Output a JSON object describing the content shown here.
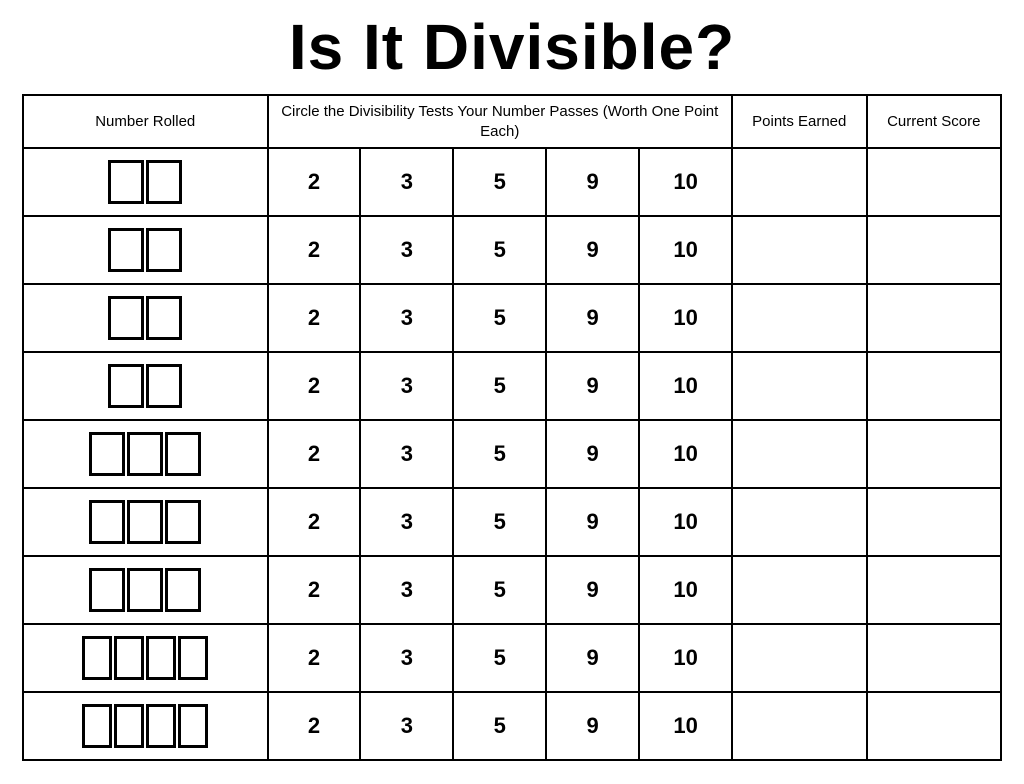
{
  "title": "Is It Divisible?",
  "table": {
    "headers": {
      "number_rolled": "Number Rolled",
      "tests": "Circle the Divisibility Tests Your Number Passes (Worth One Point Each)",
      "points_earned": "Points Earned",
      "current_score": "Current Score"
    },
    "divisors": [
      "2",
      "3",
      "5",
      "9",
      "10"
    ],
    "rows": [
      {
        "dice_count": 2
      },
      {
        "dice_count": 2
      },
      {
        "dice_count": 2
      },
      {
        "dice_count": 2
      },
      {
        "dice_count": 3
      },
      {
        "dice_count": 3
      },
      {
        "dice_count": 3
      },
      {
        "dice_count": 4
      },
      {
        "dice_count": 4
      }
    ]
  }
}
